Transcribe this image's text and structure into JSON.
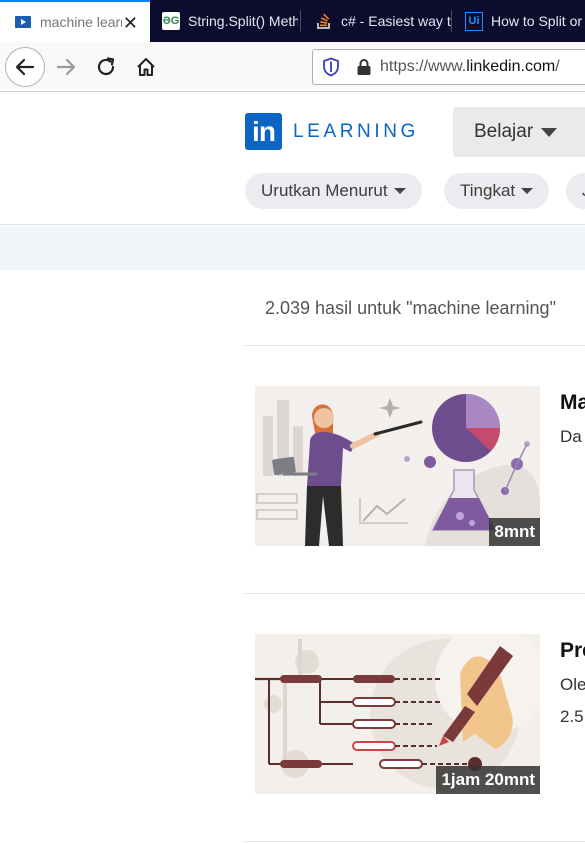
{
  "browser": {
    "tabs": [
      {
        "title": "machine learning",
        "favicon": "play-icon",
        "active": true
      },
      {
        "title": "String.Split() Method in C#",
        "favicon_text": "ƏG",
        "active": false
      },
      {
        "title": "c# - Easiest way to split",
        "favicon": "stackoverflow-icon",
        "active": false
      },
      {
        "title": "How to Split or",
        "favicon_text": "Ui",
        "active": false
      }
    ],
    "url_prefix": "https://www.",
    "url_domain": "linkedin.com",
    "url_suffix": "/"
  },
  "header": {
    "logo_mark": "in",
    "logo_word": "LEARNING",
    "learn_menu": "Belajar"
  },
  "filters": [
    {
      "label": "Urutkan Menurut"
    },
    {
      "label": "Tingkat"
    },
    {
      "label": "J"
    }
  ],
  "results": {
    "count_text": "2.039 hasil untuk \"machine learning\"",
    "items": [
      {
        "title": "Ma",
        "subtitle": "Da",
        "meta": "",
        "duration": "8mnt"
      },
      {
        "title": "Pre",
        "subtitle": "Ole",
        "meta": "2.5",
        "duration": "1jam 20mnt"
      }
    ]
  },
  "colors": {
    "brand": "#0a66c2",
    "tab_strip": "#0c0c2f",
    "active_tab_accent": "#0a84ff"
  }
}
